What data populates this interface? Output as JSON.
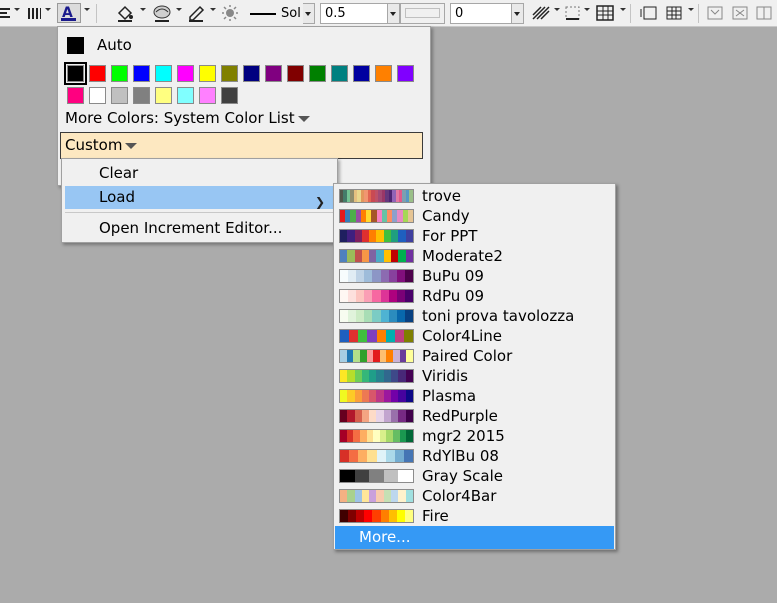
{
  "toolbar": {
    "line_style_label": "Sol",
    "line_width_value": "0.5",
    "pattern_value": "",
    "offset_value": "0"
  },
  "color_popup": {
    "auto_label": "Auto",
    "more_colors_label": "More Colors: System Color List",
    "custom_label": "Custom",
    "swatches": [
      "#000000",
      "#ff0000",
      "#00ff00",
      "#0000ff",
      "#00ffff",
      "#ff00ff",
      "#ffff00",
      "#808000",
      "#000080",
      "#800080",
      "#800000",
      "#008000",
      "#008080",
      "#0000a0",
      "#ff8000",
      "#8000ff",
      "#ff0080",
      "#ffffff",
      "#c0c0c0",
      "#808080",
      "#ffff80",
      "#80ffff",
      "#ff80ff",
      "#404040"
    ]
  },
  "context_menu": {
    "items": [
      {
        "label": "Clear"
      },
      {
        "label": "Load"
      },
      {
        "label": "Open Increment Editor..."
      }
    ]
  },
  "palette_menu": {
    "items": [
      {
        "name": "trove",
        "colors": [
          "#51574a",
          "#447c69",
          "#74c493",
          "#8e8c6d",
          "#e4bf80",
          "#e9d78e",
          "#e2975d",
          "#f19670",
          "#e16552",
          "#c94a53",
          "#be5168",
          "#a34974",
          "#993767",
          "#65387d",
          "#4e2472",
          "#9163b6",
          "#e279a3",
          "#e0598b",
          "#7c9fb0",
          "#5698c4",
          "#9abf88"
        ]
      },
      {
        "name": "Candy",
        "colors": [
          "#e41a1c",
          "#377eb8",
          "#4daf4a",
          "#984ea3",
          "#ff7f00",
          "#ffd92f",
          "#a65628",
          "#f781bf",
          "#66c2a5",
          "#fc8d62",
          "#8da0cb",
          "#e78ac3",
          "#a6d854",
          "#e5c494"
        ]
      },
      {
        "name": "For PPT",
        "colors": [
          "#1f1f5f",
          "#3f1f7f",
          "#7f1f5f",
          "#df2f2f",
          "#ff7f00",
          "#ffbf00",
          "#3fbf3f",
          "#1f9f7f",
          "#1f5fbf",
          "#3f3f9f"
        ]
      },
      {
        "name": "Moderate2",
        "colors": [
          "#4f81bd",
          "#9bbb59",
          "#c0504d",
          "#f79646",
          "#8064a2",
          "#4bacc6",
          "#ffc000",
          "#c00000",
          "#00b050",
          "#7030a0"
        ]
      },
      {
        "name": "BuPu 09",
        "colors": [
          "#f7fcfd",
          "#e0ecf4",
          "#bfd3e6",
          "#9ebcda",
          "#8c96c6",
          "#8c6bb1",
          "#88419d",
          "#810f7c",
          "#4d004b"
        ]
      },
      {
        "name": "RdPu 09",
        "colors": [
          "#fff7f3",
          "#fde0dd",
          "#fcc5c0",
          "#fa9fb5",
          "#f768a1",
          "#dd3497",
          "#ae017e",
          "#7a0177",
          "#49006a"
        ]
      },
      {
        "name": "toni prova tavolozza",
        "colors": [
          "#f7fcf0",
          "#e0f3db",
          "#ccebc5",
          "#a8ddb5",
          "#7bccc4",
          "#4eb3d3",
          "#2b8cbe",
          "#0868ac",
          "#084081"
        ]
      },
      {
        "name": "Color4Line",
        "colors": [
          "#1f5fbf",
          "#df2f2f",
          "#3fbf3f",
          "#7f3fbf",
          "#ff7f00",
          "#00afaf",
          "#bf3f7f",
          "#7f7f00"
        ]
      },
      {
        "name": "Paired Color",
        "colors": [
          "#a6cee3",
          "#1f78b4",
          "#b2df8a",
          "#33a02c",
          "#fb9a99",
          "#e31a1c",
          "#fdbf6f",
          "#ff7f00",
          "#cab2d6",
          "#6a3d9a",
          "#ffff99"
        ]
      },
      {
        "name": "Viridis",
        "colors": [
          "#fde725",
          "#b5de2b",
          "#6ece58",
          "#35b779",
          "#1f9e89",
          "#26828e",
          "#31688e",
          "#3e4989",
          "#482878",
          "#440154"
        ]
      },
      {
        "name": "Plasma",
        "colors": [
          "#f0f921",
          "#fdca26",
          "#fb9f3a",
          "#ed7953",
          "#d8576b",
          "#bd3786",
          "#9c179e",
          "#7201a8",
          "#46039f",
          "#0d0887"
        ]
      },
      {
        "name": "RedPurple",
        "colors": [
          "#67001f",
          "#b2182b",
          "#d6604d",
          "#f4a582",
          "#fddbc7",
          "#e7d4e8",
          "#c2a5cf",
          "#9970ab",
          "#762a83",
          "#40004b"
        ]
      },
      {
        "name": "mgr2 2015",
        "colors": [
          "#a50026",
          "#d73027",
          "#f46d43",
          "#fdae61",
          "#fee090",
          "#ffffbf",
          "#d9ef8b",
          "#a6d96a",
          "#66bd63",
          "#1a9850",
          "#006837"
        ]
      },
      {
        "name": "RdYlBu 08",
        "colors": [
          "#d73027",
          "#f46d43",
          "#fdae61",
          "#fee090",
          "#e0f3f8",
          "#abd9e9",
          "#74add1",
          "#4575b4"
        ]
      },
      {
        "name": "Gray Scale",
        "colors": [
          "#000000",
          "#404040",
          "#808080",
          "#c0c0c0",
          "#ffffff"
        ]
      },
      {
        "name": "Color4Bar",
        "colors": [
          "#f4b183",
          "#a9d18e",
          "#9dc3e6",
          "#ffe699",
          "#c9a0dc",
          "#f8cbad",
          "#c5e0b4",
          "#bdd7ee",
          "#fff2cc",
          "#a0e0e0"
        ]
      },
      {
        "name": "Fire",
        "colors": [
          "#3f0000",
          "#7f0000",
          "#bf0000",
          "#ff0000",
          "#ff3f00",
          "#ff7f00",
          "#ffbf00",
          "#ffff00",
          "#ffff7f"
        ]
      }
    ],
    "more_label": "More..."
  }
}
